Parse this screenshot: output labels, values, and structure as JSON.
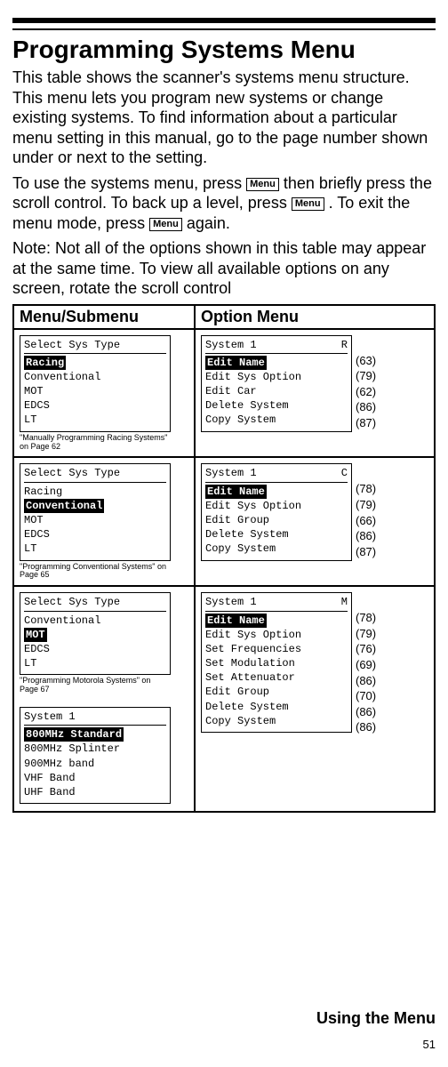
{
  "heading": "Programming Systems Menu",
  "para1": "This table shows the scanner's systems menu structure. This menu lets you program new systems or change existing systems. To find information about a particular menu setting in this manual, go to the page number shown under or next to the setting.",
  "para2a": "To use the systems menu, press ",
  "para2b": " then briefly press the scroll control. To back up a level, press ",
  "para2c": ". To exit the menu mode, press ",
  "para2d": " again.",
  "para3": "Note: Not all of the options shown in this table may appear at the same time. To view all available options on any screen, rotate the scroll control",
  "menuKey": "Menu",
  "tableHeaders": {
    "left": "Menu/Submenu",
    "right": "Option Menu"
  },
  "rows": [
    {
      "left": {
        "screenTitle": "Select Sys Type",
        "items": [
          {
            "text": "Racing",
            "highlight": true
          },
          {
            "text": "Conventional"
          },
          {
            "text": "MOT"
          },
          {
            "text": "EDCS"
          },
          {
            "text": "LT"
          }
        ],
        "caption": "\"Manually Programming Racing Systems\" on Page 62"
      },
      "right": {
        "screenTitle": "System 1",
        "suffix": "R",
        "items": [
          {
            "text": "Edit Name",
            "highlight": true,
            "page": "(63)"
          },
          {
            "text": "Edit Sys Option",
            "page": "(79)"
          },
          {
            "text": "Edit Car",
            "page": "(62)"
          },
          {
            "text": "Delete System",
            "page": "(86)"
          },
          {
            "text": "Copy System",
            "page": "(87)"
          }
        ]
      }
    },
    {
      "left": {
        "screenTitle": "Select Sys Type",
        "items": [
          {
            "text": "Racing"
          },
          {
            "text": "Conventional",
            "highlight": true
          },
          {
            "text": "MOT"
          },
          {
            "text": "EDCS"
          },
          {
            "text": "LT"
          }
        ],
        "caption": "\"Programming Conventional Systems\" on Page 65"
      },
      "right": {
        "screenTitle": "System 1",
        "suffix": "C",
        "items": [
          {
            "text": "Edit Name",
            "highlight": true,
            "page": "(78)"
          },
          {
            "text": "Edit Sys Option",
            "page": "(79)"
          },
          {
            "text": "Edit Group",
            "page": "(66)"
          },
          {
            "text": "Delete System",
            "page": "(86)"
          },
          {
            "text": "Copy System",
            "page": "(87)"
          }
        ]
      }
    },
    {
      "left": {
        "stack": [
          {
            "screenTitle": "Select Sys Type",
            "items": [
              {
                "text": "Conventional"
              },
              {
                "text": "MOT",
                "highlight": true
              },
              {
                "text": "EDCS"
              },
              {
                "text": "LT"
              }
            ],
            "caption": "\"Programming Motorola Systems\" on Page 67"
          },
          {
            "screenTitle": "System 1",
            "items": [
              {
                "text": "800MHz Standard",
                "highlight": true
              },
              {
                "text": "800MHz Splinter"
              },
              {
                "text": "900MHz band"
              },
              {
                "text": "VHF Band"
              },
              {
                "text": "UHF Band"
              }
            ]
          }
        ]
      },
      "right": {
        "screenTitle": "System 1",
        "suffix": "M",
        "items": [
          {
            "text": "Edit Name",
            "highlight": true,
            "page": "(78)"
          },
          {
            "text": "Edit Sys Option",
            "page": "(79)"
          },
          {
            "text": "Set Frequencies",
            "page": "(76)"
          },
          {
            "text": "Set Modulation",
            "page": "(69)"
          },
          {
            "text": "Set Attenuator",
            "page": "(86)"
          },
          {
            "text": "Edit Group",
            "page": "(70)"
          },
          {
            "text": "Delete System",
            "page": "(86)"
          },
          {
            "text": "Copy System",
            "page": "(86)"
          }
        ]
      }
    }
  ],
  "footer": "Using the Menu",
  "pageNumber": "51"
}
